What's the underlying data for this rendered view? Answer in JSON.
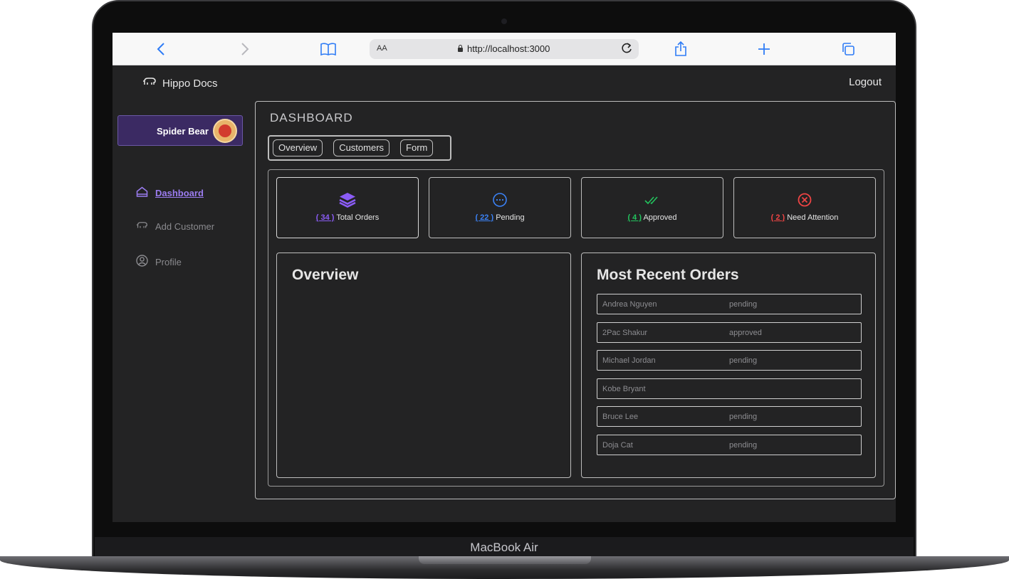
{
  "device": {
    "label": "MacBook Air"
  },
  "browser": {
    "text_size_label": "AA",
    "url": "http://localhost:3000"
  },
  "app": {
    "brand": "Hippo Docs",
    "logout_label": "Logout"
  },
  "user": {
    "name": "Spider Bear"
  },
  "sidebar": {
    "items": [
      {
        "label": "Dashboard",
        "icon": "home-icon",
        "active": true
      },
      {
        "label": "Add Customer",
        "icon": "hippo-icon",
        "active": false
      },
      {
        "label": "Profile",
        "icon": "user-circle-icon",
        "active": false
      }
    ]
  },
  "page": {
    "title": "DASHBOARD"
  },
  "tabs": [
    "Overview",
    "Customers",
    "Form"
  ],
  "stats": [
    {
      "count": "( 34 )",
      "label": "Total Orders",
      "icon": "layers-icon",
      "color": "#8b5cf6"
    },
    {
      "count": "( 22 )",
      "label": "Pending",
      "icon": "dots-circle-icon",
      "color": "#3b82f6"
    },
    {
      "count": "( 4 )",
      "label": "Approved",
      "icon": "double-check-icon",
      "color": "#22c55e"
    },
    {
      "count": "( 2 )",
      "label": "Need Attention",
      "icon": "x-circle-icon",
      "color": "#ef4444"
    }
  ],
  "overview": {
    "title": "Overview"
  },
  "recent_orders": {
    "title": "Most Recent Orders",
    "rows": [
      {
        "name": "Andrea Nguyen",
        "status": "pending"
      },
      {
        "name": "2Pac Shakur",
        "status": "approved"
      },
      {
        "name": "Michael Jordan",
        "status": "pending"
      },
      {
        "name": "Kobe Bryant",
        "status": ""
      },
      {
        "name": "Bruce Lee",
        "status": "pending"
      },
      {
        "name": "Doja Cat",
        "status": "pending"
      }
    ]
  }
}
